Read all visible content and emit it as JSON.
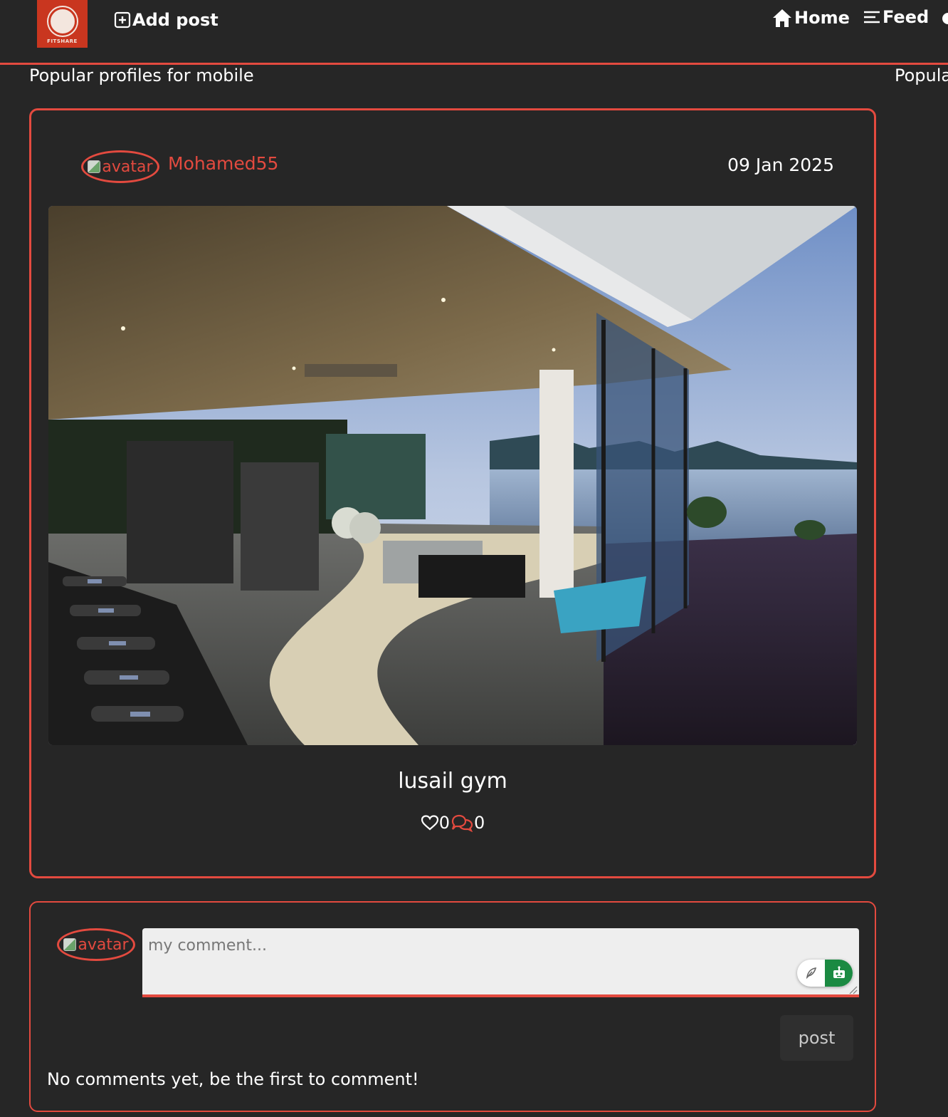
{
  "brand": {
    "logo_text": "FITSHARE",
    "color": "#c9361f"
  },
  "nav": {
    "add_post_label": "Add post",
    "home_label": "Home",
    "feed_label": "Feed"
  },
  "sections": {
    "popular_mobile": "Popular profiles for mobile",
    "popular_right": "Popular"
  },
  "post": {
    "avatar_alt": "avatar",
    "username": "Mohamed55",
    "date": "09 Jan 2025",
    "title": "lusail gym",
    "likes": "0",
    "comments": "0"
  },
  "comment_form": {
    "avatar_alt": "avatar",
    "placeholder": "my comment...",
    "submit_label": "post",
    "empty_text": "No comments yet, be the first to comment!"
  },
  "theme": {
    "accent": "#e34a3f",
    "background": "#262626",
    "extension_green": "#1b8a42"
  }
}
